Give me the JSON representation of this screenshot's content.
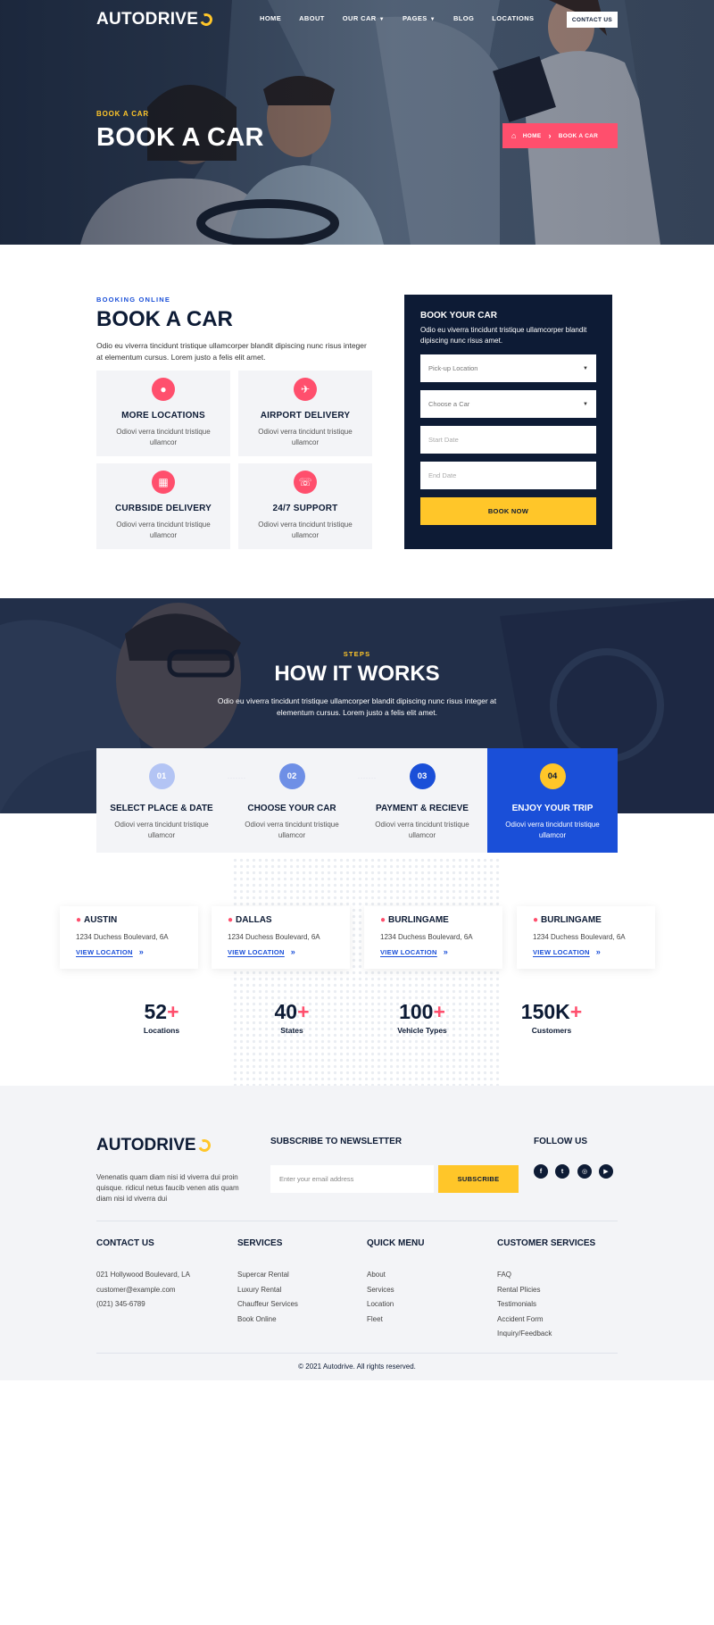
{
  "brand": {
    "logo_text": "AUTODRIVE",
    "accent": "#ffc629",
    "pink": "#ff4f6d",
    "blue": "#1a4fd8",
    "navy": "#0d1b35"
  },
  "nav": {
    "items": [
      {
        "label": "HOME"
      },
      {
        "label": "ABOUT"
      },
      {
        "label": "OUR CAR",
        "caret": "chevron-down-icon"
      },
      {
        "label": "PAGES",
        "caret": "chevron-down-icon"
      },
      {
        "label": "BLOG"
      },
      {
        "label": "LOCATIONS"
      }
    ],
    "contact_label": "CONTACT US"
  },
  "hero": {
    "eyebrow": "BOOK A CAR",
    "title": "BOOK A CAR",
    "breadcrumb": {
      "home": "HOME",
      "current": "BOOK A CAR"
    }
  },
  "booking": {
    "eyebrow": "BOOKING ONLINE",
    "title": "BOOK A CAR",
    "description": "Odio eu viverra tincidunt tristique ullamcorper blandit dipiscing nunc risus integer at elementum cursus. Lorem justo a felis elit amet.",
    "features": [
      {
        "icon": "location-pin-icon",
        "title": "MORE LOCATIONS",
        "text": "Odiovi verra tincidunt tristique ullamcor"
      },
      {
        "icon": "airplane-icon",
        "title": "AIRPORT DELIVERY",
        "text": "Odiovi verra tincidunt tristique ullamcor"
      },
      {
        "icon": "building-icon",
        "title": "CURBSIDE DELIVERY",
        "text": "Odiovi verra tincidunt tristique ullamcor"
      },
      {
        "icon": "headset-icon",
        "title": "24/7 SUPPORT",
        "text": "Odiovi verra tincidunt tristique ullamcor"
      }
    ],
    "form": {
      "title": "BOOK YOUR CAR",
      "description": "Odio eu viverra tincidunt tristique ullamcorper blandit dipiscing nunc risus amet.",
      "pickup_placeholder": "Pick-up Location",
      "car_placeholder": "Choose a Car",
      "start_placeholder": "Start Date",
      "end_placeholder": "End Date",
      "submit_label": "BOOK NOW"
    }
  },
  "how": {
    "eyebrow": "STEPS",
    "title": "HOW IT WORKS",
    "description": "Odio eu viverra tincidunt tristique ullamcorper blandit dipiscing nunc risus integer at elementum cursus. Lorem justo a felis elit amet.",
    "steps": [
      {
        "num": "01",
        "title": "SELECT PLACE & DATE",
        "text": "Odiovi verra tincidunt tristique ullamcor",
        "color": "#b3c4f4"
      },
      {
        "num": "02",
        "title": "CHOOSE YOUR CAR",
        "text": "Odiovi verra tincidunt tristique ullamcor",
        "color": "#6e8fe6"
      },
      {
        "num": "03",
        "title": "PAYMENT & RECIEVE",
        "text": "Odiovi verra tincidunt tristique ullamcor",
        "color": "#1a4fd8"
      },
      {
        "num": "04",
        "title": "ENJOY YOUR TRIP",
        "text": "Odiovi verra tincidunt tristique ullamcor",
        "color": "#ffc629"
      }
    ]
  },
  "locations": [
    {
      "name": "AUSTIN",
      "address": "1234 Duchess Boulevard, 6A",
      "link": "VIEW LOCATION"
    },
    {
      "name": "DALLAS",
      "address": "1234 Duchess Boulevard, 6A",
      "link": "VIEW LOCATION"
    },
    {
      "name": "BURLINGAME",
      "address": "1234 Duchess Boulevard, 6A",
      "link": "VIEW LOCATION"
    },
    {
      "name": "BURLINGAME",
      "address": "1234 Duchess Boulevard, 6A",
      "link": "VIEW LOCATION"
    }
  ],
  "stats": [
    {
      "value": "52",
      "plus": "+",
      "label": "Locations"
    },
    {
      "value": "40",
      "plus": "+",
      "label": "States"
    },
    {
      "value": "100",
      "plus": "+",
      "label": "Vehicle Types"
    },
    {
      "value": "150K",
      "plus": "+",
      "label": "Customers"
    }
  ],
  "footer": {
    "about": "Venenatis quam diam nisi id viverra dui proin quisque. ridicul netus faucib venen atis quam diam nisi id viverra dui",
    "newsletter_title": "SUBSCRIBE TO NEWSLETTER",
    "email_placeholder": "Enter your email address",
    "subscribe_label": "SUBSCRIBE",
    "follow_title": "FOLLOW US",
    "social": [
      {
        "icon": "facebook-icon",
        "glyph": "f"
      },
      {
        "icon": "twitter-icon",
        "glyph": "t"
      },
      {
        "icon": "instagram-icon",
        "glyph": "◎"
      },
      {
        "icon": "youtube-icon",
        "glyph": "▶"
      }
    ],
    "columns": [
      {
        "title": "CONTACT US",
        "items": [
          "021 Hollywood Boulevard, LA",
          "customer@example.com",
          "(021) 345-6789"
        ]
      },
      {
        "title": "SERVICES",
        "items": [
          "Supercar Rental",
          "Luxury Rental",
          "Chauffeur Services",
          "Book Online"
        ]
      },
      {
        "title": "QUICK MENU",
        "items": [
          "About",
          "Services",
          "Location",
          "Fleet"
        ]
      },
      {
        "title": "CUSTOMER SERVICES",
        "items": [
          "FAQ",
          "Rental Plicies",
          "Testimonials",
          "Accident Form",
          "Inquiry/Feedback"
        ]
      }
    ],
    "copyright": "© 2021 Autodrive. All rights reserved."
  }
}
